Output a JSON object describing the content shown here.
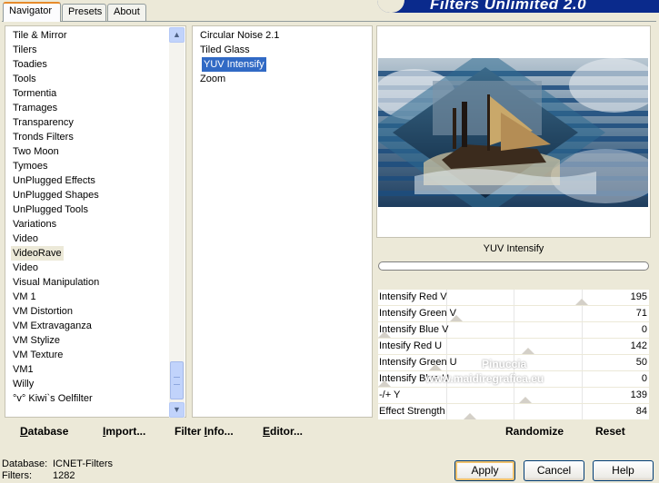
{
  "tabs": [
    {
      "label": "Navigator",
      "active": true
    },
    {
      "label": "Presets",
      "active": false
    },
    {
      "label": "About",
      "active": false
    }
  ],
  "banner_title": "Filters Unlimited 2.0",
  "categories": [
    "Tile & Mirror",
    "Tilers",
    "Toadies",
    "Tools",
    "Tormentia",
    "Tramages",
    "Transparency",
    "Tronds Filters",
    "Two Moon",
    "Tymoes",
    "UnPlugged Effects",
    "UnPlugged Shapes",
    "UnPlugged Tools",
    "Variations",
    "Video",
    "VideoRave",
    "Video",
    "Visual Manipulation",
    "VM 1",
    "VM Distortion",
    "VM Extravaganza",
    "VM Stylize",
    "VM Texture",
    "VM1",
    "Willy",
    "°v° Kiwi`s Oelfilter"
  ],
  "selected_category": "VideoRave",
  "filters": [
    "Circular Noise 2.1",
    "Tiled Glass",
    "YUV Intensify",
    "Zoom"
  ],
  "selected_filter": "YUV Intensify",
  "left_buttons": {
    "database": {
      "first": "D",
      "rest": "atabase"
    },
    "import": {
      "first": "I",
      "rest": "mport..."
    },
    "filter_info": {
      "before": "Filter ",
      "first": "I",
      "rest": "nfo..."
    },
    "editor": {
      "first": "E",
      "rest": "ditor..."
    }
  },
  "filter_title": "YUV Intensify",
  "params": [
    {
      "label": "Intensify Red V",
      "value": 195,
      "max": 255
    },
    {
      "label": "Intensify Green V",
      "value": 71,
      "max": 255
    },
    {
      "label": "Intensify Blue V",
      "value": 0,
      "max": 255
    },
    {
      "label": "Intesify Red U",
      "value": 142,
      "max": 255
    },
    {
      "label": "Intensify Green U",
      "value": 50,
      "max": 255
    },
    {
      "label": "Intensify Blue U",
      "value": 0,
      "max": 255
    },
    {
      "label": "-/+ Y",
      "value": 139,
      "max": 255
    },
    {
      "label": "Effect Strength",
      "value": 84,
      "max": 255
    }
  ],
  "randomize_label": "Randomize",
  "reset_label": "Reset",
  "watermark": {
    "line1": "Pinuccia",
    "line2": "www.maidiregrafica.eu"
  },
  "status": {
    "database_label": "Database:",
    "database_value": "ICNET-Filters",
    "filters_label": "Filters:",
    "filters_value": "1282"
  },
  "dialog_buttons": {
    "apply": "Apply",
    "cancel": "Cancel",
    "help": "Help"
  },
  "colors": {
    "selection": "#316ac5",
    "banner": "#0a2a8c",
    "window_bg": "#ece9d8"
  }
}
